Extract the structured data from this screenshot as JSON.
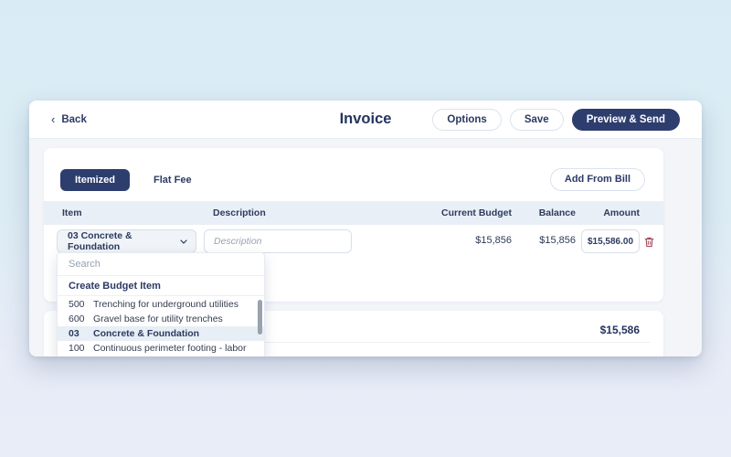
{
  "header": {
    "back_label": "Back",
    "title": "Invoice",
    "options_label": "Options",
    "save_label": "Save",
    "preview_send_label": "Preview & Send"
  },
  "toolbar": {
    "tab_itemized": "Itemized",
    "tab_flat_fee": "Flat Fee",
    "add_from_bill_label": "Add From Bill"
  },
  "table": {
    "columns": [
      "Item",
      "Description",
      "Current Budget",
      "Balance",
      "Amount"
    ],
    "row": {
      "item_selected": "03 Concrete & Foundation",
      "description_placeholder": "Description",
      "current_budget": "$15,856",
      "balance": "$15,856",
      "amount_value": "$15,586.00"
    }
  },
  "dropdown": {
    "search_placeholder": "Search",
    "create_label": "Create Budget Item",
    "items": [
      {
        "code": "500",
        "label": "Trenching for underground utilities",
        "selected": false
      },
      {
        "code": "600",
        "label": "Gravel base for utility trenches",
        "selected": false
      },
      {
        "code": "03",
        "label": "Concrete & Foundation",
        "selected": true
      },
      {
        "code": "100",
        "label": "Continuous perimeter footing - labor",
        "selected": false
      }
    ]
  },
  "summary": {
    "total": "$15,586"
  },
  "icons": {
    "back_chevron": "‹",
    "trash": "trash-icon",
    "select_chevron": "chevron-down-icon"
  },
  "colors": {
    "accent_navy": "#2d3e6e",
    "title_navy": "#25345f",
    "table_header_bg": "#e9eff7",
    "selected_item_bg": "#e8eef5",
    "danger_trash": "#a5495b",
    "page_bg_top": "#d9ecf5",
    "page_bg_bottom": "#e9edf8"
  }
}
